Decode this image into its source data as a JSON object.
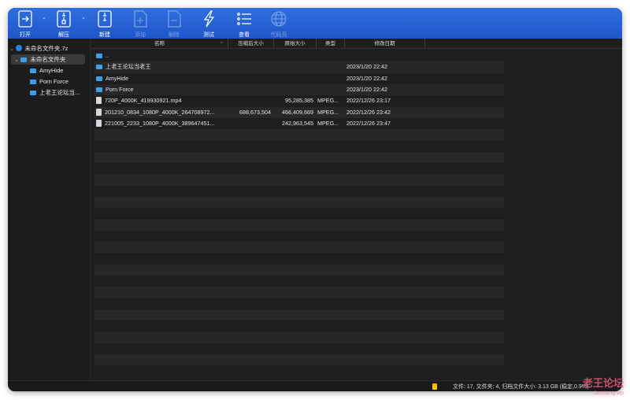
{
  "toolbar": {
    "open": "打开",
    "extract": "解压",
    "new": "新建",
    "add": "添加",
    "delete": "删除",
    "test": "测试",
    "view": "查看",
    "codepage": "代码页"
  },
  "sidebar": {
    "archive": "未命名文件夹.7z",
    "root": "未命名文件夹",
    "children": [
      "AmyHide",
      "Porn Force",
      "上老王论坛当..."
    ]
  },
  "columns": {
    "name": "名称",
    "compressed": "压缩后大小",
    "original": "原始大小",
    "type": "类型",
    "modified": "修改日期"
  },
  "rows": [
    {
      "name": "..",
      "compressed": "",
      "original": "",
      "type": "",
      "modified": "",
      "kind": "folder"
    },
    {
      "name": "上老王论坛当老王",
      "compressed": "",
      "original": "",
      "type": "",
      "modified": "2023/1/20 22:42",
      "kind": "folder"
    },
    {
      "name": "AmyHide",
      "compressed": "",
      "original": "",
      "type": "",
      "modified": "2023/1/20 22:42",
      "kind": "folder"
    },
    {
      "name": "Porn Force",
      "compressed": "",
      "original": "",
      "type": "",
      "modified": "2023/1/20 22:42",
      "kind": "folder"
    },
    {
      "name": "720P_4000K_419930921.mp4",
      "compressed": "",
      "original": "95,285,385",
      "type": "MPEG...",
      "modified": "2022/12/26 23:17",
      "kind": "file"
    },
    {
      "name": "201210_0834_1080P_4000K_264708972...",
      "compressed": "688,673,504",
      "original": "466,409,669",
      "type": "MPEG...",
      "modified": "2022/12/26 23:42",
      "kind": "file"
    },
    {
      "name": "221005_2233_1080P_4000K_389647451...",
      "compressed": "",
      "original": "242,963,545",
      "type": "MPEG...",
      "modified": "2022/12/26 23:47",
      "kind": "file"
    }
  ],
  "status": {
    "text": "文件: 17, 文件夹: 4, 归档文件大小: 3.13 GB (稳定,0.9%)"
  },
  "watermark": {
    "title": "老王论坛",
    "url": "laowang.vip"
  }
}
